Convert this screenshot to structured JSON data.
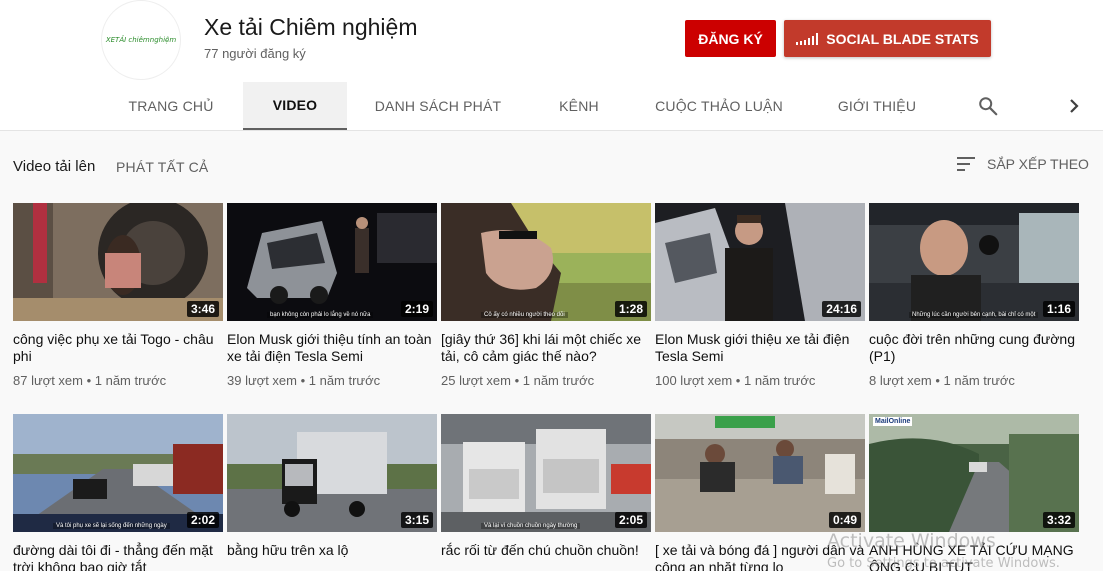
{
  "channel": {
    "name": "Xe tải Chiêm nghiệm",
    "subscribers": "77 người đăng ký",
    "logo_text": "XETẢI chiêmnghiệm",
    "subscribe_label": "ĐĂNG KÝ",
    "social_blade_label": "SOCIAL BLADE STATS",
    "subscribe_color": "#cc0000",
    "social_blade_color": "#c23a2b"
  },
  "tabs": [
    {
      "label": "TRANG CHỦ",
      "active": false
    },
    {
      "label": "VIDEO",
      "active": true
    },
    {
      "label": "DANH SÁCH PHÁT",
      "active": false
    },
    {
      "label": "KÊNH",
      "active": false
    },
    {
      "label": "CUỘC THẢO LUẬN",
      "active": false
    },
    {
      "label": "GIỚI THIỆU",
      "active": false
    }
  ],
  "tab_icons": {
    "search": "search-icon",
    "next": "chevron-right-icon"
  },
  "section": {
    "title": "Video tải lên",
    "play_all": "PHÁT TẤT CẢ",
    "sort_label": "SẮP XẾP THEO",
    "sort_icon": "sort-icon"
  },
  "videos": [
    {
      "title": "công việc phụ xe tải Togo - châu phi",
      "duration": "3:46",
      "meta": "87 lượt xem • 1 năm trước"
    },
    {
      "title": "Elon Musk giới thiệu tính an toàn xe tải điện Tesla Semi",
      "duration": "2:19",
      "meta": "39 lượt xem • 1 năm trước",
      "caption": "bạn không còn phải lo lắng về nó nữa"
    },
    {
      "title": "[giây thứ 36] khi lái một chiếc xe tải, cô cảm giác thế nào?",
      "duration": "1:28",
      "meta": "25 lượt xem • 1 năm trước",
      "caption": "Cô ấy có nhiều người theo dõi"
    },
    {
      "title": "Elon Musk giới thiệu xe tải điện Tesla Semi",
      "duration": "24:16",
      "meta": "100 lượt xem • 1 năm trước"
    },
    {
      "title": "cuộc đời trên những cung đường (P1)",
      "duration": "1:16",
      "meta": "8 lượt xem • 1 năm trước",
      "caption": "Những lúc cần người bên cạnh, bài chỉ có một"
    },
    {
      "title": "đường dài tôi đi - thẳng đến mặt trời không bao giờ tắt",
      "duration": "2:02",
      "meta": "",
      "caption": "Và tôi phụ xe sẽ lại sống đến những ngày"
    },
    {
      "title": "bằng hữu trên xa lộ",
      "duration": "3:15",
      "meta": ""
    },
    {
      "title": "rắc rối từ đến chú chuồn chuồn!",
      "duration": "2:05",
      "meta": "",
      "caption": "Và lại vì chuồn chuồn ngày thường"
    },
    {
      "title": "[ xe tải và bóng đá ] người dân và công an nhặt từng lo",
      "duration": "0:49",
      "meta": ""
    },
    {
      "title": "ANH HÙNG XE TẢI CỨU MẠNG ÔNG CỤ BỊ TỤT",
      "duration": "3:32",
      "meta": "",
      "badge": "MailOnline"
    }
  ],
  "overlay": {
    "activate_windows": "Activate Windows",
    "go_to_settings": "Go to Settings to activate Windows."
  }
}
